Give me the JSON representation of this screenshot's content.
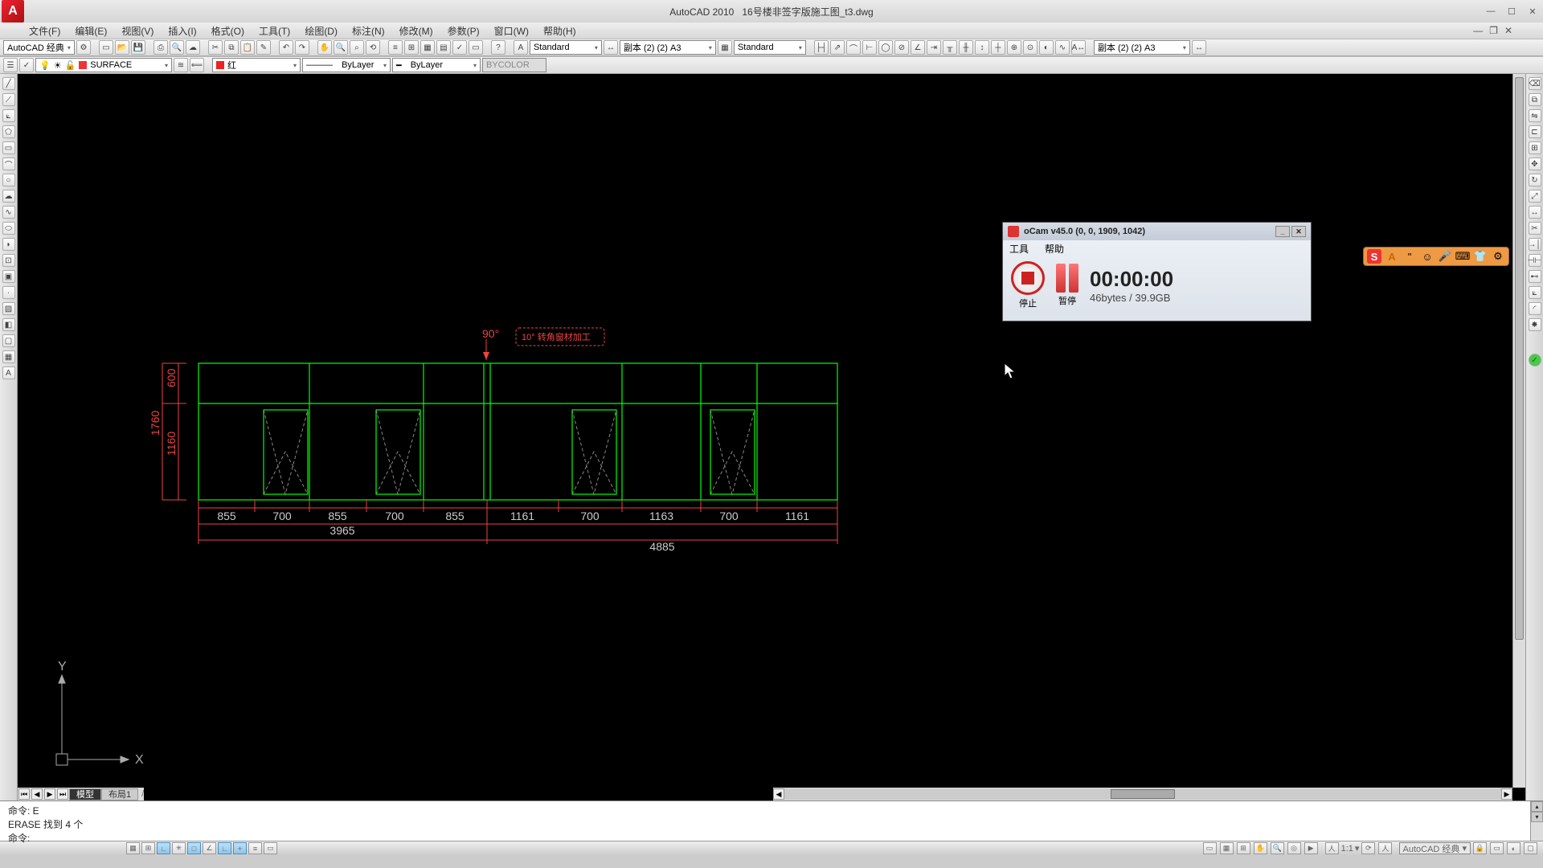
{
  "title": {
    "app": "AutoCAD 2010",
    "file": "16号楼非签字版施工图_t3.dwg"
  },
  "menu": [
    "文件(F)",
    "编辑(E)",
    "视图(V)",
    "插入(I)",
    "格式(O)",
    "工具(T)",
    "绘图(D)",
    "标注(N)",
    "修改(M)",
    "参数(P)",
    "窗口(W)",
    "帮助(H)"
  ],
  "workspace": "AutoCAD 经典",
  "layer": "SURFACE",
  "color": "红",
  "linetype1": "ByLayer",
  "linetype2": "ByLayer",
  "lineweight": "BYCOLOR",
  "textstyle": "Standard",
  "dimstyle": "副本 (2) (2) A3",
  "tablestyle": "Standard",
  "annoscale": "副本 (2) (2) A3",
  "tabs": {
    "model": "模型",
    "layout1": "布局1"
  },
  "cmd": {
    "l1": "命令: E",
    "l2": "ERASE 找到 4 个",
    "l3": "命令:"
  },
  "status": {
    "scale": "1:1",
    "ws": "AutoCAD 经典"
  },
  "ocam": {
    "title": "oCam v45.0 (0, 0, 1909, 1042)",
    "menu": [
      "工具",
      "帮助"
    ],
    "stop": "停止",
    "pause": "暂停",
    "timer": "00:00:00",
    "size": "46bytes / 39.9GB"
  },
  "drawing": {
    "angle": "90°",
    "label": "10° 转角窗材加工",
    "dims_v": {
      "top": "600",
      "bottom": "1160",
      "total": "1760"
    },
    "dims_h": [
      "855",
      "700",
      "855",
      "700",
      "855",
      "1161",
      "700",
      "1163",
      "700",
      "1161"
    ],
    "seg_left": "3965",
    "seg_right": "4885"
  }
}
